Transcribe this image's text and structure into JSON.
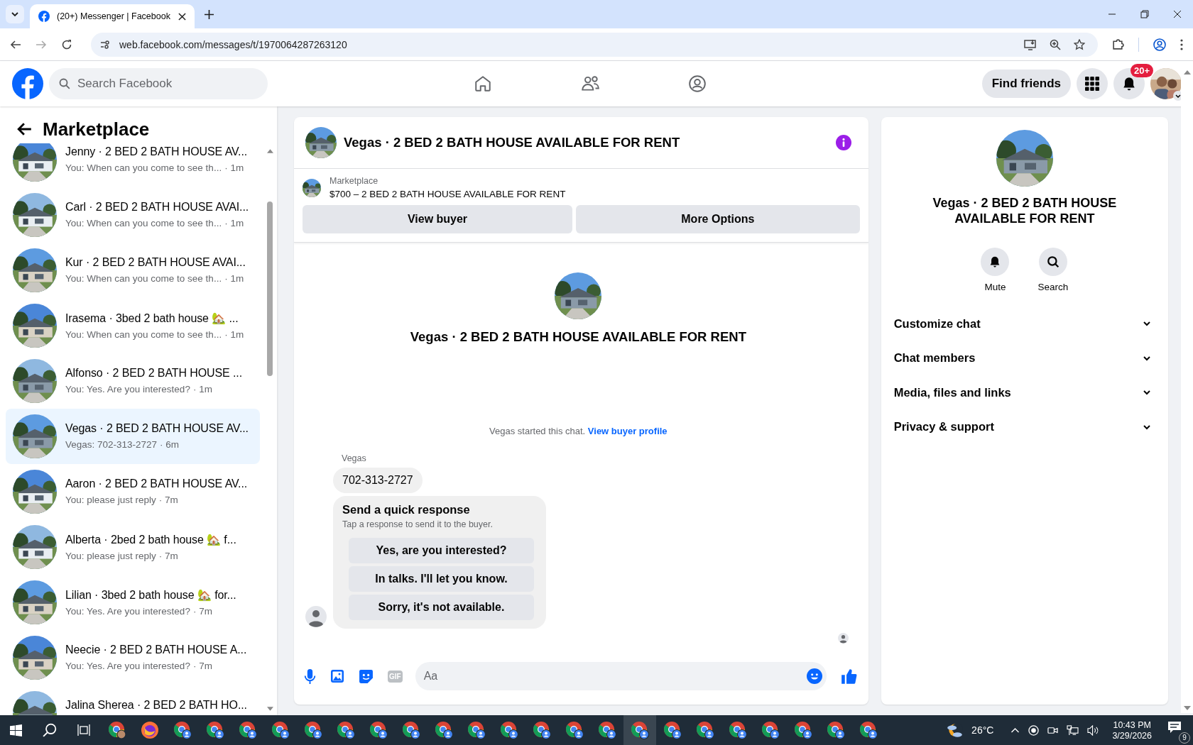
{
  "browser": {
    "tab_title": "(20+) Messenger | Facebook",
    "url": "web.facebook.com/messages/t/1970064287263120"
  },
  "header": {
    "search_placeholder": "Search Facebook",
    "find_friends": "Find friends",
    "notification_badge": "20+"
  },
  "sidebar": {
    "title": "Marketplace",
    "conversations": [
      {
        "title": "Jenny · 2 BED 2 BATH HOUSE AV...",
        "preview": "You: When can you come to see th...",
        "time": "· 1m",
        "selected": false
      },
      {
        "title": "Carl · 2 BED 2 BATH HOUSE AVAI...",
        "preview": "You: When can you come to see th...",
        "time": "· 1m",
        "selected": false
      },
      {
        "title": "Kur · 2 BED 2 BATH HOUSE AVAI...",
        "preview": "You: When can you come to see th...",
        "time": "· 1m",
        "selected": false
      },
      {
        "title": "Irasema · 3bed 2 bath house 🏡 ...",
        "preview": "You: When can you come to see th...",
        "time": "· 1m",
        "selected": false
      },
      {
        "title": "Alfonso · 2 BED 2 BATH HOUSE ...",
        "preview": "You: Yes. Are you interested?",
        "time": "· 1m",
        "selected": false
      },
      {
        "title": "Vegas · 2 BED 2 BATH HOUSE AV...",
        "preview": "Vegas: 702-313-2727",
        "time": "· 6m",
        "selected": true
      },
      {
        "title": "Aaron · 2 BED 2 BATH HOUSE AV...",
        "preview": "You: please just reply",
        "time": "· 7m",
        "selected": false
      },
      {
        "title": "Alberta · 2bed 2 bath house 🏡 f...",
        "preview": "You: please just reply",
        "time": "· 7m",
        "selected": false
      },
      {
        "title": "Lilian · 3bed 2 bath house 🏡 for...",
        "preview": "You: Yes. Are you interested?",
        "time": "· 7m",
        "selected": false
      },
      {
        "title": "Neecie · 2 BED 2 BATH HOUSE A...",
        "preview": "You: Yes. Are you interested?",
        "time": "· 7m",
        "selected": false
      },
      {
        "title": "Jalina Sherea · 2 BED 2 BATH HO...",
        "selected": false
      }
    ]
  },
  "chat": {
    "title": "Vegas · 2 BED 2 BATH HOUSE AVAILABLE FOR RENT",
    "listing": {
      "source": "Marketplace",
      "title": "$700 – 2 BED 2 BATH HOUSE AVAILABLE FOR RENT",
      "buttons": [
        "View buyer",
        "More Options"
      ]
    },
    "intro_title": "Vegas · 2 BED 2 BATH HOUSE AVAILABLE FOR RENT",
    "system_message": {
      "text": "Vegas started this chat.",
      "link": "View buyer profile"
    },
    "message": {
      "sender": "Vegas",
      "text": "702-313-2727"
    },
    "quick_response": {
      "title": "Send a quick response",
      "subtitle": "Tap a response to send it to the buyer.",
      "options": [
        "Yes, are you interested?",
        "In talks. I'll let you know.",
        "Sorry, it's not available."
      ]
    },
    "composer": {
      "gif_label": "GIF",
      "placeholder": "Aa"
    }
  },
  "details": {
    "title": "Vegas · 2 BED 2 BATH HOUSE AVAILABLE FOR RENT",
    "actions": [
      {
        "kind": "mute",
        "label": "Mute"
      },
      {
        "kind": "search",
        "label": "Search"
      }
    ],
    "sections": [
      "Customize chat",
      "Chat members",
      "Media, files and links",
      "Privacy & support"
    ]
  },
  "taskbar": {
    "apps": [
      {
        "kind": "chrome",
        "selected": false
      },
      {
        "kind": "firefox",
        "selected": false
      },
      {
        "kind": "chrome-profile",
        "selected": false
      },
      {
        "kind": "chrome-profile",
        "selected": false
      },
      {
        "kind": "chrome-profile",
        "selected": false
      },
      {
        "kind": "chrome-profile",
        "selected": false
      },
      {
        "kind": "chrome-profile",
        "selected": false
      },
      {
        "kind": "chrome-profile",
        "selected": false
      },
      {
        "kind": "chrome-profile",
        "selected": false
      },
      {
        "kind": "chrome-profile",
        "selected": false
      },
      {
        "kind": "chrome-profile",
        "selected": false
      },
      {
        "kind": "chrome-profile",
        "selected": false
      },
      {
        "kind": "chrome-profile",
        "selected": false
      },
      {
        "kind": "chrome-profile",
        "selected": false
      },
      {
        "kind": "chrome-profile",
        "selected": false
      },
      {
        "kind": "chrome-profile",
        "selected": false
      },
      {
        "kind": "chrome-profile",
        "selected": true
      },
      {
        "kind": "chrome-profile",
        "selected": false
      },
      {
        "kind": "chrome-profile",
        "selected": false
      },
      {
        "kind": "chrome-profile",
        "selected": false
      },
      {
        "kind": "chrome-profile",
        "selected": false
      },
      {
        "kind": "chrome-profile",
        "selected": false
      },
      {
        "kind": "chrome-profile",
        "selected": false
      },
      {
        "kind": "chrome-profile",
        "selected": false
      }
    ],
    "temperature": "26°C",
    "time": "10:43 PM",
    "date": "3/29/2026",
    "notification_count": "9"
  }
}
